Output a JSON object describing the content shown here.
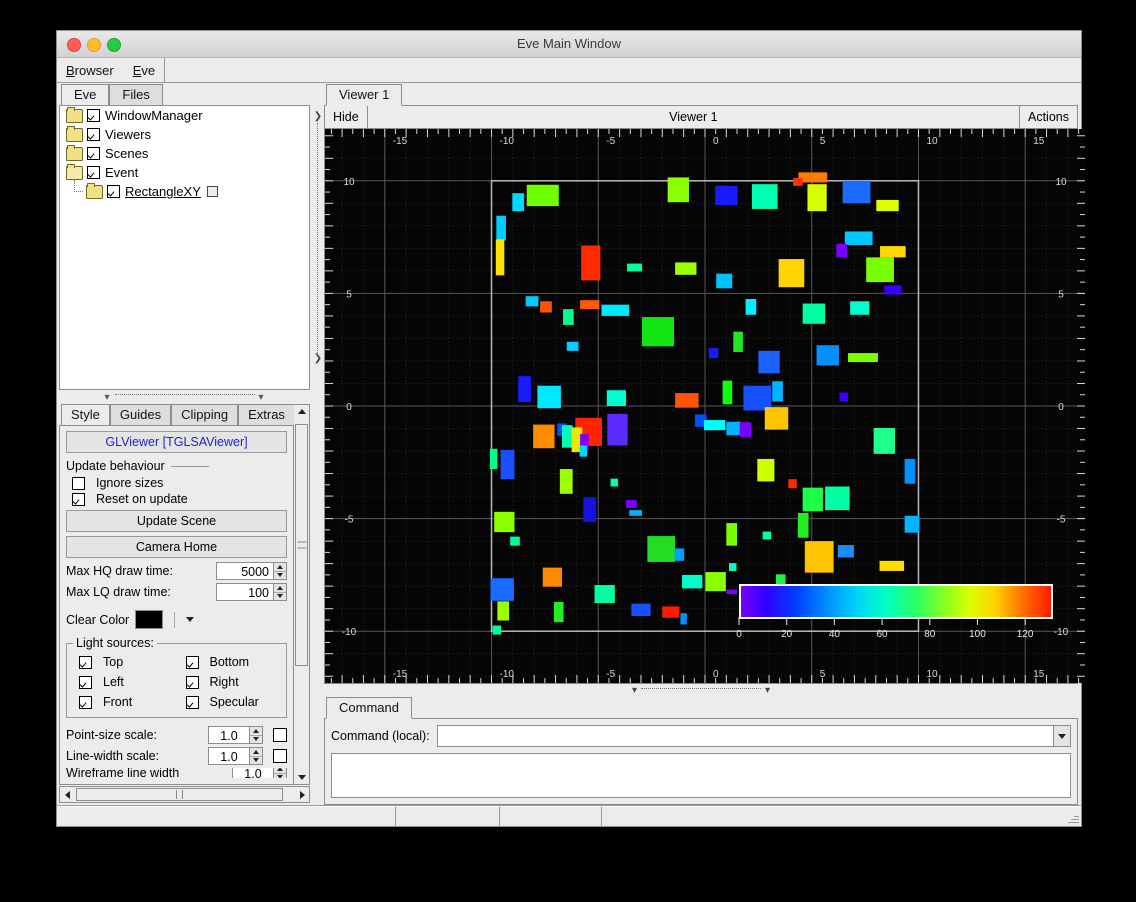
{
  "window": {
    "title": "Eve Main Window"
  },
  "menubar": {
    "items": [
      {
        "label": "Browser",
        "accel": "B"
      },
      {
        "label": "Eve",
        "accel": "E"
      }
    ]
  },
  "browser": {
    "tabs": [
      {
        "label": "Eve",
        "selected": true
      },
      {
        "label": "Files",
        "selected": false
      }
    ],
    "tree": [
      {
        "label": "WindowManager",
        "checked": true,
        "indent": 0,
        "open": false,
        "underline": false,
        "extra": false
      },
      {
        "label": "Viewers",
        "checked": true,
        "indent": 0,
        "open": false,
        "underline": false,
        "extra": false
      },
      {
        "label": "Scenes",
        "checked": true,
        "indent": 0,
        "open": false,
        "underline": false,
        "extra": false
      },
      {
        "label": "Event",
        "checked": true,
        "indent": 0,
        "open": true,
        "underline": false,
        "extra": false
      },
      {
        "label": "RectangleXY",
        "checked": true,
        "indent": 1,
        "open": false,
        "underline": true,
        "extra": true
      }
    ]
  },
  "style_panel": {
    "tabs": [
      {
        "label": "Style",
        "selected": true
      },
      {
        "label": "Guides",
        "selected": false
      },
      {
        "label": "Clipping",
        "selected": false
      },
      {
        "label": "Extras",
        "selected": false
      }
    ],
    "header": "GLViewer [TGLSAViewer]",
    "update_behaviour_label": "Update behaviour",
    "ignore_sizes": {
      "label": "Ignore sizes",
      "checked": false
    },
    "reset_on_update": {
      "label": "Reset on update",
      "checked": true
    },
    "update_scene_button": "Update Scene",
    "camera_home_button": "Camera Home",
    "max_hq_draw_time": {
      "label": "Max HQ draw time:",
      "value": "5000"
    },
    "max_lq_draw_time": {
      "label": "Max LQ draw time:",
      "value": "100"
    },
    "clear_color": {
      "label": "Clear Color",
      "value": "#000000"
    },
    "lights": {
      "legend": "Light sources:",
      "items": [
        {
          "label": "Top",
          "checked": true
        },
        {
          "label": "Bottom",
          "checked": true
        },
        {
          "label": "Left",
          "checked": true
        },
        {
          "label": "Right",
          "checked": true
        },
        {
          "label": "Front",
          "checked": true
        },
        {
          "label": "Specular",
          "checked": true
        }
      ]
    },
    "point_size_scale": {
      "label": "Point-size scale:",
      "value": "1.0",
      "checked": false
    },
    "line_width_scale": {
      "label": "Line-width scale:",
      "value": "1.0",
      "checked": false
    },
    "wireframe_line_width": {
      "label": "Wireframe line width",
      "value": "1.0"
    }
  },
  "viewer": {
    "tabs": [
      {
        "label": "Viewer 1",
        "selected": true
      }
    ],
    "hide_button": "Hide",
    "title": "Viewer 1",
    "actions_button": "Actions"
  },
  "command": {
    "tabs": [
      {
        "label": "Command",
        "selected": true
      }
    ],
    "label": "Command (local):",
    "value": "",
    "placeholder": "",
    "log": ""
  },
  "statusbar": {
    "cells": [
      "",
      "",
      "",
      ""
    ]
  },
  "chart_data": {
    "type": "scatter",
    "title": "",
    "xlabel": "",
    "ylabel": "",
    "xlim": [
      -17.8,
      17.8
    ],
    "ylim": [
      -12.3,
      12.3
    ],
    "x_ticks": [
      -15,
      -10,
      -5,
      0,
      5,
      10,
      15
    ],
    "y_ticks": [
      -10,
      -5,
      0,
      5,
      10
    ],
    "grid": true,
    "background": "#050505",
    "axis_color": "#d8d8d8",
    "frame_box": {
      "x0": -10,
      "y0": -10,
      "x1": 10,
      "y1": 10
    },
    "colorbar": {
      "min": 0,
      "max": 130,
      "ticks": [
        0,
        20,
        40,
        60,
        80,
        100,
        120
      ],
      "orientation": "horizontal",
      "colormap": "rainbow"
    },
    "marker_shape": "rectangle",
    "note": "Each point is an axis-aligned rectangle; cx,cy are data coords, w,h are data-unit sizes, c is the fill color.",
    "points": [
      {
        "cx": -8.75,
        "cy": 9.05,
        "w": 0.55,
        "h": 0.8,
        "c": "#00d9ff"
      },
      {
        "cx": -7.6,
        "cy": 9.35,
        "w": 1.5,
        "h": 0.95,
        "c": "#6eff00"
      },
      {
        "cx": -1.25,
        "cy": 9.6,
        "w": 1.0,
        "h": 1.1,
        "c": "#8cff00"
      },
      {
        "cx": 1.0,
        "cy": 9.35,
        "w": 1.05,
        "h": 0.85,
        "c": "#1a1aff"
      },
      {
        "cx": 2.8,
        "cy": 9.3,
        "w": 1.2,
        "h": 1.1,
        "c": "#00ffb0"
      },
      {
        "cx": 5.05,
        "cy": 10.15,
        "w": 1.35,
        "h": 0.45,
        "c": "#ff7a00"
      },
      {
        "cx": 4.35,
        "cy": 9.95,
        "w": 0.45,
        "h": 0.35,
        "c": "#ff3000"
      },
      {
        "cx": 5.25,
        "cy": 9.25,
        "w": 0.9,
        "h": 1.2,
        "c": "#d8ff00"
      },
      {
        "cx": 7.1,
        "cy": 9.5,
        "w": 1.3,
        "h": 1.0,
        "c": "#1a6bff"
      },
      {
        "cx": 8.55,
        "cy": 8.9,
        "w": 1.05,
        "h": 0.5,
        "c": "#ddff00"
      },
      {
        "cx": -9.55,
        "cy": 7.9,
        "w": 0.45,
        "h": 1.1,
        "c": "#00ccff"
      },
      {
        "cx": -9.6,
        "cy": 6.6,
        "w": 0.4,
        "h": 1.6,
        "c": "#ffe000"
      },
      {
        "cx": 7.2,
        "cy": 7.45,
        "w": 1.3,
        "h": 0.6,
        "c": "#00c8ff"
      },
      {
        "cx": 6.4,
        "cy": 6.9,
        "w": 0.5,
        "h": 0.6,
        "c": "#7a00ff"
      },
      {
        "cx": 8.8,
        "cy": 6.85,
        "w": 1.2,
        "h": 0.5,
        "c": "#ffd800"
      },
      {
        "cx": -5.35,
        "cy": 6.35,
        "w": 0.9,
        "h": 1.55,
        "c": "#ff2a00"
      },
      {
        "cx": -3.3,
        "cy": 6.15,
        "w": 0.7,
        "h": 0.35,
        "c": "#00ff9a"
      },
      {
        "cx": -0.9,
        "cy": 6.1,
        "w": 1.0,
        "h": 0.55,
        "c": "#9cff00"
      },
      {
        "cx": 0.9,
        "cy": 5.55,
        "w": 0.75,
        "h": 0.65,
        "c": "#00c0ff"
      },
      {
        "cx": 4.05,
        "cy": 5.9,
        "w": 1.2,
        "h": 1.25,
        "c": "#ffd400"
      },
      {
        "cx": 8.2,
        "cy": 6.05,
        "w": 1.3,
        "h": 1.1,
        "c": "#7aff00"
      },
      {
        "cx": 8.8,
        "cy": 5.15,
        "w": 0.8,
        "h": 0.4,
        "c": "#3a00ff"
      },
      {
        "cx": -8.1,
        "cy": 4.65,
        "w": 0.6,
        "h": 0.45,
        "c": "#00ccff"
      },
      {
        "cx": -7.45,
        "cy": 4.4,
        "w": 0.55,
        "h": 0.5,
        "c": "#ff5500"
      },
      {
        "cx": -5.4,
        "cy": 4.5,
        "w": 0.9,
        "h": 0.4,
        "c": "#ff5a00"
      },
      {
        "cx": -6.4,
        "cy": 3.95,
        "w": 0.5,
        "h": 0.7,
        "c": "#00ff8a"
      },
      {
        "cx": -4.2,
        "cy": 4.25,
        "w": 1.3,
        "h": 0.5,
        "c": "#00e8ff"
      },
      {
        "cx": 2.15,
        "cy": 4.4,
        "w": 0.5,
        "h": 0.7,
        "c": "#00f0ff"
      },
      {
        "cx": 5.1,
        "cy": 4.1,
        "w": 1.05,
        "h": 0.9,
        "c": "#00ffa0"
      },
      {
        "cx": 7.25,
        "cy": 4.35,
        "w": 0.9,
        "h": 0.6,
        "c": "#00ffd0"
      },
      {
        "cx": -2.2,
        "cy": 3.3,
        "w": 1.5,
        "h": 1.3,
        "c": "#12e512"
      },
      {
        "cx": -6.2,
        "cy": 2.65,
        "w": 0.55,
        "h": 0.4,
        "c": "#00d0ff"
      },
      {
        "cx": 1.55,
        "cy": 2.85,
        "w": 0.45,
        "h": 0.9,
        "c": "#22e822"
      },
      {
        "cx": 0.4,
        "cy": 2.35,
        "w": 0.45,
        "h": 0.45,
        "c": "#1a1aff"
      },
      {
        "cx": 3.0,
        "cy": 1.95,
        "w": 1.0,
        "h": 1.0,
        "c": "#1e60ff"
      },
      {
        "cx": 5.75,
        "cy": 2.25,
        "w": 1.05,
        "h": 0.9,
        "c": "#0090ff"
      },
      {
        "cx": 7.4,
        "cy": 2.15,
        "w": 1.4,
        "h": 0.4,
        "c": "#7aff00"
      },
      {
        "cx": -8.45,
        "cy": 0.75,
        "w": 0.6,
        "h": 1.15,
        "c": "#1a1aff"
      },
      {
        "cx": -7.3,
        "cy": 0.4,
        "w": 1.1,
        "h": 1.0,
        "c": "#00e8ff"
      },
      {
        "cx": -4.15,
        "cy": 0.35,
        "w": 0.9,
        "h": 0.7,
        "c": "#00ffd0"
      },
      {
        "cx": -0.85,
        "cy": 0.25,
        "w": 1.1,
        "h": 0.65,
        "c": "#ff5500"
      },
      {
        "cx": 1.05,
        "cy": 0.6,
        "w": 0.45,
        "h": 1.05,
        "c": "#0eff0e"
      },
      {
        "cx": 2.45,
        "cy": 0.35,
        "w": 1.3,
        "h": 1.1,
        "c": "#1550ff"
      },
      {
        "cx": 3.4,
        "cy": 0.65,
        "w": 0.5,
        "h": 0.9,
        "c": "#00b4ff"
      },
      {
        "cx": 6.5,
        "cy": 0.4,
        "w": 0.4,
        "h": 0.4,
        "c": "#3a00ff"
      },
      {
        "cx": 3.35,
        "cy": -0.55,
        "w": 1.1,
        "h": 1.0,
        "c": "#ffc400"
      },
      {
        "cx": -0.2,
        "cy": -0.65,
        "w": 0.55,
        "h": 0.55,
        "c": "#0050ff"
      },
      {
        "cx": 0.45,
        "cy": -0.85,
        "w": 1.0,
        "h": 0.45,
        "c": "#00ffff"
      },
      {
        "cx": 1.35,
        "cy": -1.0,
        "w": 0.7,
        "h": 0.6,
        "c": "#00b4ff"
      },
      {
        "cx": 1.9,
        "cy": -1.05,
        "w": 0.55,
        "h": 0.65,
        "c": "#7a00ff"
      },
      {
        "cx": -5.45,
        "cy": -1.15,
        "w": 1.25,
        "h": 1.25,
        "c": "#ff2400"
      },
      {
        "cx": -4.1,
        "cy": -1.05,
        "w": 0.95,
        "h": 1.4,
        "c": "#5a2aff"
      },
      {
        "cx": -6.7,
        "cy": -1.05,
        "w": 0.45,
        "h": 0.55,
        "c": "#0050ff"
      },
      {
        "cx": -7.55,
        "cy": -1.35,
        "w": 1.0,
        "h": 1.05,
        "c": "#ff8c00"
      },
      {
        "cx": -6.45,
        "cy": -1.35,
        "w": 0.5,
        "h": 1.0,
        "c": "#00ffb4"
      },
      {
        "cx": -6.0,
        "cy": -1.5,
        "w": 0.5,
        "h": 1.1,
        "c": "#e8e800"
      },
      {
        "cx": -5.65,
        "cy": -1.6,
        "w": 0.4,
        "h": 0.7,
        "c": "#7a00ff"
      },
      {
        "cx": -5.7,
        "cy": -2.0,
        "w": 0.35,
        "h": 0.5,
        "c": "#00d8ff"
      },
      {
        "cx": 8.4,
        "cy": -1.55,
        "w": 1.0,
        "h": 1.15,
        "c": "#1eff8c"
      },
      {
        "cx": 2.85,
        "cy": -2.85,
        "w": 0.8,
        "h": 1.0,
        "c": "#ccff00"
      },
      {
        "cx": -9.25,
        "cy": -2.6,
        "w": 0.65,
        "h": 1.3,
        "c": "#1a50ff"
      },
      {
        "cx": -9.9,
        "cy": -2.35,
        "w": 0.35,
        "h": 0.9,
        "c": "#00ff88"
      },
      {
        "cx": 4.1,
        "cy": -3.45,
        "w": 0.4,
        "h": 0.4,
        "c": "#ff2a00"
      },
      {
        "cx": 9.6,
        "cy": -2.9,
        "w": 0.5,
        "h": 1.1,
        "c": "#0090ff"
      },
      {
        "cx": -6.5,
        "cy": -3.35,
        "w": 0.6,
        "h": 1.1,
        "c": "#9cff00"
      },
      {
        "cx": -4.25,
        "cy": -3.4,
        "w": 0.35,
        "h": 0.35,
        "c": "#00ffa8"
      },
      {
        "cx": 5.05,
        "cy": -4.15,
        "w": 0.95,
        "h": 1.05,
        "c": "#1eff4a"
      },
      {
        "cx": 6.2,
        "cy": -4.1,
        "w": 1.15,
        "h": 1.05,
        "c": "#00ffa0"
      },
      {
        "cx": -3.45,
        "cy": -4.35,
        "w": 0.5,
        "h": 0.35,
        "c": "#7a00ff"
      },
      {
        "cx": -5.4,
        "cy": -4.6,
        "w": 0.6,
        "h": 1.1,
        "c": "#1512e0"
      },
      {
        "cx": -3.25,
        "cy": -4.75,
        "w": 0.6,
        "h": 0.25,
        "c": "#00b4ff"
      },
      {
        "cx": -9.4,
        "cy": -5.15,
        "w": 0.95,
        "h": 0.9,
        "c": "#8cff00"
      },
      {
        "cx": 4.6,
        "cy": -5.3,
        "w": 0.5,
        "h": 1.1,
        "c": "#22ee22"
      },
      {
        "cx": 9.7,
        "cy": -5.25,
        "w": 0.7,
        "h": 0.75,
        "c": "#00b4ff"
      },
      {
        "cx": -8.9,
        "cy": -6.0,
        "w": 0.45,
        "h": 0.4,
        "c": "#00ff9a"
      },
      {
        "cx": 1.25,
        "cy": -5.7,
        "w": 0.5,
        "h": 1.0,
        "c": "#7aff00"
      },
      {
        "cx": 2.9,
        "cy": -5.75,
        "w": 0.4,
        "h": 0.35,
        "c": "#00ffb4"
      },
      {
        "cx": -2.05,
        "cy": -6.35,
        "w": 1.3,
        "h": 1.15,
        "c": "#22dd22"
      },
      {
        "cx": -1.2,
        "cy": -6.6,
        "w": 0.45,
        "h": 0.55,
        "c": "#00a0ff"
      },
      {
        "cx": 5.35,
        "cy": -6.7,
        "w": 1.35,
        "h": 1.4,
        "c": "#ffc400"
      },
      {
        "cx": 6.6,
        "cy": -6.45,
        "w": 0.75,
        "h": 0.55,
        "c": "#1e8cff"
      },
      {
        "cx": 8.75,
        "cy": -7.1,
        "w": 1.15,
        "h": 0.45,
        "c": "#ffdd00"
      },
      {
        "cx": 3.55,
        "cy": -7.85,
        "w": 0.45,
        "h": 0.75,
        "c": "#22ee44"
      },
      {
        "cx": -0.6,
        "cy": -7.8,
        "w": 0.95,
        "h": 0.6,
        "c": "#00ffc8"
      },
      {
        "cx": 0.5,
        "cy": -7.8,
        "w": 0.95,
        "h": 0.85,
        "c": "#8cff00"
      },
      {
        "cx": -7.15,
        "cy": -7.6,
        "w": 0.9,
        "h": 0.85,
        "c": "#ff8800"
      },
      {
        "cx": -9.5,
        "cy": -8.15,
        "w": 1.1,
        "h": 1.0,
        "c": "#1a6bff"
      },
      {
        "cx": -4.7,
        "cy": -8.35,
        "w": 0.95,
        "h": 0.8,
        "c": "#00ffa0"
      },
      {
        "cx": 1.25,
        "cy": -8.25,
        "w": 0.5,
        "h": 0.2,
        "c": "#7a00ff"
      },
      {
        "cx": 5.0,
        "cy": -8.35,
        "w": 1.2,
        "h": 0.45,
        "c": "#ff8800"
      },
      {
        "cx": -9.45,
        "cy": -9.1,
        "w": 0.55,
        "h": 0.85,
        "c": "#9cff00"
      },
      {
        "cx": -6.85,
        "cy": -9.15,
        "w": 0.45,
        "h": 0.9,
        "c": "#22ee22"
      },
      {
        "cx": -3.0,
        "cy": -9.05,
        "w": 0.9,
        "h": 0.55,
        "c": "#1a50ff"
      },
      {
        "cx": -1.6,
        "cy": -9.15,
        "w": 0.8,
        "h": 0.5,
        "c": "#ff1a00"
      },
      {
        "cx": -1.0,
        "cy": -9.45,
        "w": 0.3,
        "h": 0.5,
        "c": "#0090ff"
      },
      {
        "cx": -9.75,
        "cy": -9.95,
        "w": 0.4,
        "h": 0.4,
        "c": "#00ff9a"
      },
      {
        "cx": 1.3,
        "cy": -7.15,
        "w": 0.35,
        "h": 0.35,
        "c": "#00ffc8"
      }
    ]
  }
}
